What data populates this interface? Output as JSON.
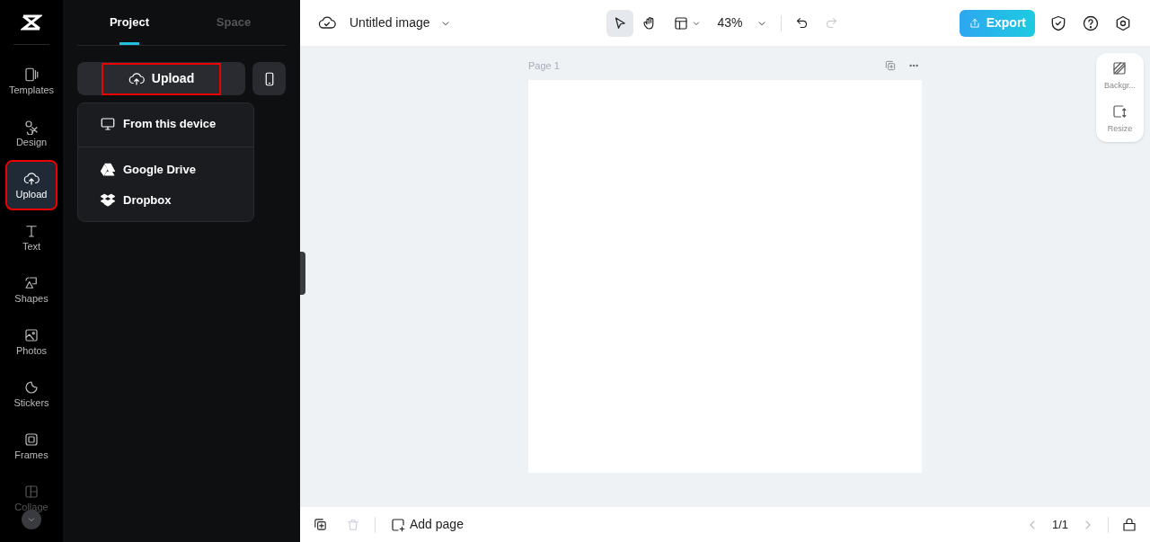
{
  "rail": {
    "items": [
      {
        "label": "Templates",
        "selected": false,
        "highlighted": false
      },
      {
        "label": "Design",
        "selected": false,
        "highlighted": false
      },
      {
        "label": "Upload",
        "selected": true,
        "highlighted": true
      },
      {
        "label": "Text",
        "selected": false,
        "highlighted": false
      },
      {
        "label": "Shapes",
        "selected": false,
        "highlighted": false
      },
      {
        "label": "Photos",
        "selected": false,
        "highlighted": false
      },
      {
        "label": "Stickers",
        "selected": false,
        "highlighted": false
      },
      {
        "label": "Frames",
        "selected": false,
        "highlighted": false
      },
      {
        "label": "Collage",
        "selected": false,
        "highlighted": false,
        "disabled": true
      }
    ]
  },
  "panel": {
    "tabs": [
      {
        "label": "Project",
        "selected": true
      },
      {
        "label": "Space",
        "selected": false
      }
    ],
    "upload_button": {
      "label": "Upload",
      "highlighted": true
    },
    "menu": [
      {
        "label": "From this device",
        "divider_before": false
      },
      {
        "label": "Google Drive",
        "divider_before": true
      },
      {
        "label": "Dropbox",
        "divider_before": false
      }
    ]
  },
  "toolbar": {
    "title": "Untitled image",
    "zoom": "43%",
    "export": "Export",
    "redo_disabled": true,
    "tools": [
      {
        "selected": true
      },
      {
        "selected": false
      }
    ]
  },
  "canvas": {
    "page_label": "Page 1"
  },
  "side_tools": [
    {
      "label": "Backgr..."
    },
    {
      "label": "Resize"
    }
  ],
  "bottom_bar": {
    "add_page": "Add page",
    "page_count": "1/1",
    "delete_disabled": true
  }
}
